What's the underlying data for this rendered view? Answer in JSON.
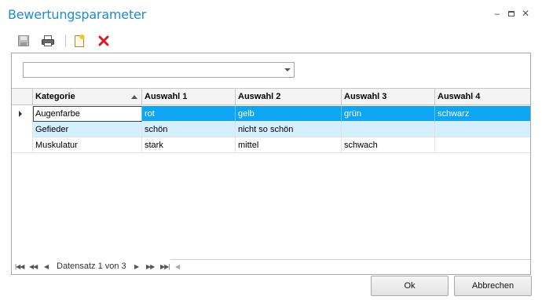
{
  "window": {
    "title": "Bewertungsparameter"
  },
  "toolbar": {
    "icons": [
      "save-icon",
      "print-icon",
      "new-icon",
      "delete-icon"
    ]
  },
  "filter": {
    "value": ""
  },
  "grid": {
    "columns": [
      "Kategorie",
      "Auswahl 1",
      "Auswahl 2",
      "Auswahl 3",
      "Auswahl 4"
    ],
    "rows": [
      [
        "Augenfarbe",
        "rot",
        "gelb",
        "grün",
        "schwarz"
      ],
      [
        "Gefieder",
        "schön",
        "nicht so schön",
        "",
        ""
      ],
      [
        "Muskulatur",
        "stark",
        "mittel",
        "schwach",
        ""
      ]
    ],
    "selected_row": 0,
    "sorted_column": "Kategorie",
    "sort_direction": "ascending"
  },
  "navigator": {
    "record_text": "Datensatz 1 von 3"
  },
  "buttons": {
    "ok": "Ok",
    "cancel": "Abbrechen"
  },
  "colors": {
    "title": "#1e8ad6",
    "selection": "#0fa5f5",
    "alt_row": "#d4f0ff"
  }
}
